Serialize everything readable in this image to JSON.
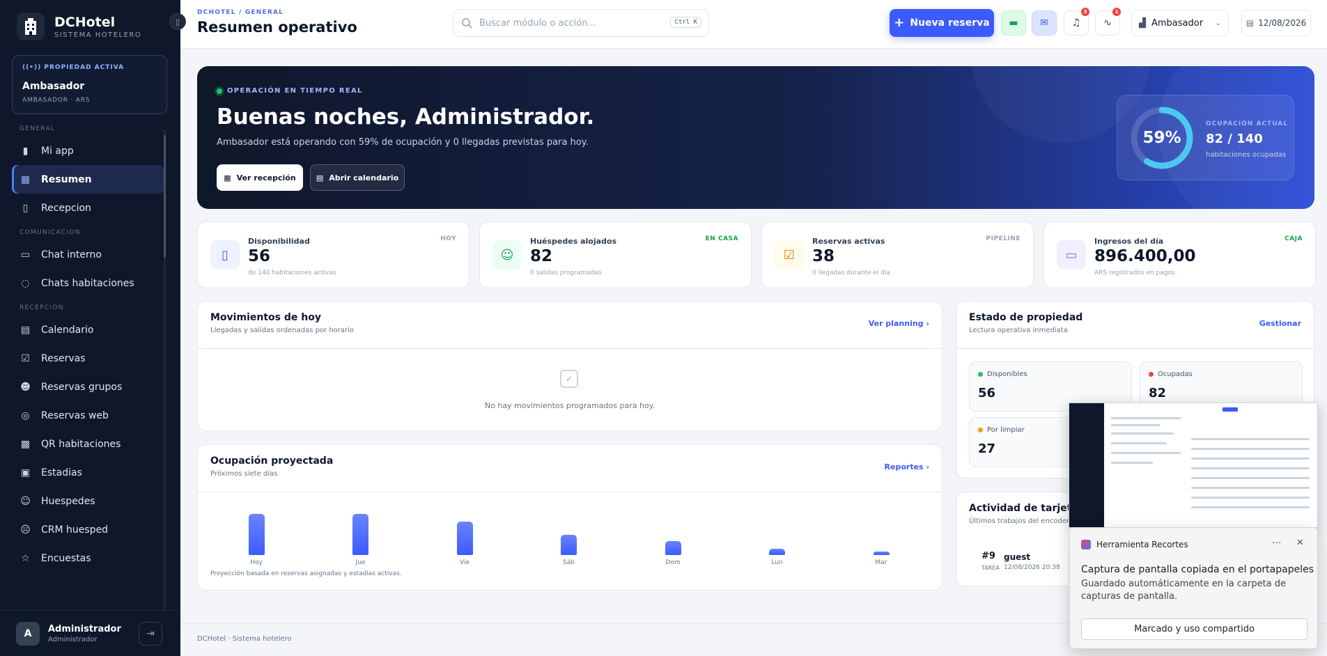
{
  "sidebar": {
    "brand": {
      "name": "DCHotel",
      "subtitle": "SISTEMA HOTELERO"
    },
    "property": {
      "tag": "PROPIEDAD ACTIVA",
      "name": "Ambasador",
      "meta": "AMBASADOR · ARS"
    },
    "sections": {
      "general": "GENERAL",
      "comunicacion": "COMUNICACION",
      "recepcion": "RECEPCION"
    },
    "items": {
      "mi_app": "Mi app",
      "resumen": "Resumen",
      "recepcion": "Recepcion",
      "chat_interno": "Chat interno",
      "chats_habitaciones": "Chats habitaciones",
      "calendario": "Calendario",
      "reservas": "Reservas",
      "reservas_grupos": "Reservas grupos",
      "reservas_web": "Reservas web",
      "qr_habitaciones": "QR habitaciones",
      "estadias": "Estadias",
      "huespedes": "Huespedes",
      "crm_huesped": "CRM huesped",
      "encuestas": "Encuestas"
    },
    "user": {
      "initial": "A",
      "name": "Administrador",
      "role": "Administrador"
    }
  },
  "header": {
    "breadcrumb": "DCHOTEL / GENERAL",
    "title": "Resumen operativo",
    "search_placeholder": "Buscar módulo o acción...",
    "shortcut": "Ctrl K",
    "new_booking": "Nueva reserva",
    "notifications_count": "3",
    "activity_count": "1",
    "property_select": "Ambasador",
    "date": "12/08/2026"
  },
  "hero": {
    "live_tag": "OPERACIÓN EN TIEMPO REAL",
    "greeting": "Buenas noches, Administrador.",
    "description": "Ambasador está operando con 59% de ocupación y 0 llegadas previstas para hoy.",
    "btn_reception": "Ver recepción",
    "btn_calendar": "Abrir calendario",
    "occupancy": {
      "percent": "59%",
      "percent_value": 59,
      "label": "OCUPACIÓN ACTUAL",
      "value": "82 / 140",
      "sub": "habitaciones ocupadas"
    }
  },
  "stats": [
    {
      "label": "Disponibilidad",
      "value": "56",
      "sub": "de 140 habitaciones activas",
      "tag": "HOY"
    },
    {
      "label": "Huéspedes alojados",
      "value": "82",
      "sub": "0 salidas programadas",
      "tag": "EN CASA"
    },
    {
      "label": "Reservas activas",
      "value": "38",
      "sub": "0 llegadas durante el día",
      "tag": "PIPELINE"
    },
    {
      "label": "Ingresos del día",
      "value": "896.400,00",
      "sub": "ARS registrados en pagos",
      "tag": "CAJA"
    }
  ],
  "movements": {
    "title": "Movimientos de hoy",
    "subtitle": "Llegadas y salidas ordenadas por horario",
    "link": "Ver planning",
    "empty": "No hay movimientos programados para hoy."
  },
  "projection": {
    "title": "Ocupación proyectada",
    "subtitle": "Próximos siete días",
    "link": "Reportes",
    "note": "Proyección basada en reservas asignadas y estadías activas."
  },
  "chart_data": {
    "type": "bar",
    "categories": [
      "Hoy",
      "Jue",
      "Vie",
      "Sáb",
      "Dom",
      "Lun",
      "Mar"
    ],
    "values": [
      59,
      59,
      48,
      29,
      20,
      9,
      5
    ],
    "ylim": [
      0,
      100
    ],
    "title": "Ocupación proyectada",
    "xlabel": "",
    "ylabel": ""
  },
  "property_state": {
    "title": "Estado de propiedad",
    "subtitle": "Lectura operativa inmediata",
    "link": "Gestionar",
    "items": [
      {
        "label": "Disponibles",
        "value": "56",
        "color": "#22c55e"
      },
      {
        "label": "Ocupadas",
        "value": "82",
        "color": "#ef4444"
      },
      {
        "label": "Por limpiar",
        "value": "27",
        "color": "#f59e0b"
      }
    ]
  },
  "activity": {
    "title": "Actividad de tarjetas",
    "subtitle": "Últimos trabajos del encoder",
    "items": [
      {
        "num": "#9",
        "kind": "TAREA",
        "title": "guest",
        "time": "12/08/2026 20:38"
      }
    ]
  },
  "footer": {
    "text": "DCHotel · Sistema hotelero"
  },
  "snipping": {
    "app_name": "Herramienta Recortes",
    "title": "Captura de pantalla copiada en el portapapeles",
    "body": "Guardado automáticamente en la carpeta de capturas de pantalla.",
    "button": "Marcado y uso compartido"
  },
  "colors": {
    "accent": "#3b5bfd",
    "sidebar": "#0f172a",
    "success": "#22c55e",
    "danger": "#ef4444",
    "warning": "#f59e0b"
  }
}
